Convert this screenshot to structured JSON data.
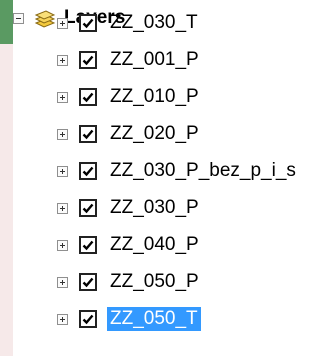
{
  "toc": {
    "header": {
      "label": "Layers",
      "icon": "layers-stack-icon",
      "expanded": true
    },
    "layers": [
      {
        "label": "ZZ_030_T",
        "checked": true,
        "selected": false
      },
      {
        "label": "ZZ_001_P",
        "checked": true,
        "selected": false
      },
      {
        "label": "ZZ_010_P",
        "checked": true,
        "selected": false
      },
      {
        "label": "ZZ_020_P",
        "checked": true,
        "selected": false
      },
      {
        "label": "ZZ_030_P_bez_p_i_s",
        "checked": true,
        "selected": false
      },
      {
        "label": "ZZ_030_P",
        "checked": true,
        "selected": false
      },
      {
        "label": "ZZ_040_P",
        "checked": true,
        "selected": false
      },
      {
        "label": "ZZ_050_P",
        "checked": true,
        "selected": false
      },
      {
        "label": "ZZ_050_T",
        "checked": true,
        "selected": true
      }
    ]
  },
  "colors": {
    "accent_green": "#5a9a62",
    "panel_pink": "#f6e9e9",
    "selection_blue": "#3399ff",
    "layers_icon_yellow": "#f3c93c"
  }
}
